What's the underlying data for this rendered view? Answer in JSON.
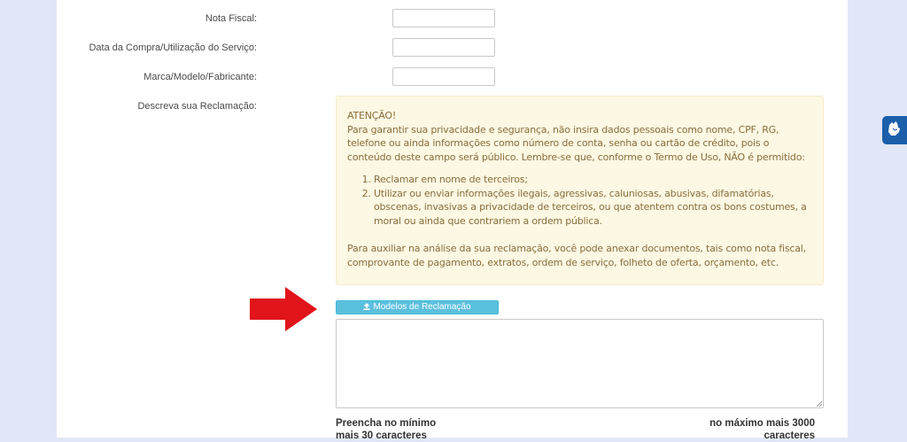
{
  "form": {
    "nota_fiscal_label": "Nota Fiscal:",
    "data_compra_label": "Data da Compra/Utilização do Serviço:",
    "marca_label": "Marca/Modelo/Fabricante:",
    "descreva_label": "Descreva sua Reclamação:",
    "nota_fiscal_value": "",
    "data_compra_value": "",
    "marca_value": "",
    "reclamacao_value": ""
  },
  "alert": {
    "title": "ATENÇÃO!",
    "intro": "Para garantir sua privacidade e segurança, não insira dados pessoais como nome, CPF, RG, telefone ou ainda informações como número de conta, senha ou cartão de crédito, pois o conteúdo deste campo será público. Lembre-se que, conforme o Termo de Uso, NÃO é permitido:",
    "items": [
      "Reclamar em nome de terceiros;",
      "Utilizar ou enviar informações ilegais, agressivas, caluniosas, abusivas, difamatórias, obscenas, invasivas a privacidade de terceiros, ou que atentem contra os bons costumes, a moral ou ainda que contrariem a ordem pública."
    ],
    "footer": "Para auxiliar na análise da sua reclamação, você pode anexar documentos, tais como nota fiscal, comprovante de pagamento, extratos, ordem de serviço, folheto de oferta, orçamento, etc."
  },
  "buttons": {
    "models_label": "Modelos de Reclamação"
  },
  "hints": {
    "min_line1": "Preencha no mínimo",
    "min_line2": "mais 30 caracteres",
    "max_line1": "no máximo mais 3000",
    "max_line2": "caracteres"
  },
  "colors": {
    "page_bg": "#e2e7f7",
    "alert_bg": "#fcf8e3",
    "alert_text": "#8a6d3b",
    "button_bg": "#5bc0de",
    "arrow": "#e0141a",
    "a11y_bg": "#1b5fab"
  },
  "icons": {
    "upload": "upload-icon",
    "accessibility": "sign-language-icon"
  }
}
